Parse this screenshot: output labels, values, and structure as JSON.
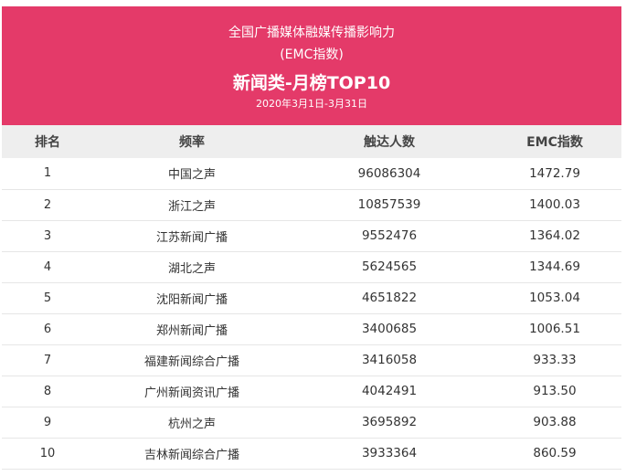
{
  "header": {
    "subtitle_line1": "全国广播媒体融媒传播影响力",
    "subtitle_line2": "(EMC指数)",
    "title": "新闻类-月榜TOP10",
    "date_range": "2020年3月1日-3月31日",
    "background_color": "#e43a69"
  },
  "table": {
    "columns": [
      "排名",
      "频率",
      "触达人数",
      "EMC指数"
    ],
    "rows": [
      {
        "rank": "1",
        "name": "中国之声",
        "reach": "96086304",
        "emc": "1472.79"
      },
      {
        "rank": "2",
        "name": "浙江之声",
        "reach": "10857539",
        "emc": "1400.03"
      },
      {
        "rank": "3",
        "name": "江苏新闻广播",
        "reach": "9552476",
        "emc": "1364.02"
      },
      {
        "rank": "4",
        "name": "湖北之声",
        "reach": "5624565",
        "emc": "1344.69"
      },
      {
        "rank": "5",
        "name": "沈阳新闻广播",
        "reach": "4651822",
        "emc": "1053.04"
      },
      {
        "rank": "6",
        "name": "郑州新闻广播",
        "reach": "3400685",
        "emc": "1006.51"
      },
      {
        "rank": "7",
        "name": "福建新闻综合广播",
        "reach": "3416058",
        "emc": "933.33"
      },
      {
        "rank": "8",
        "name": "广州新闻资讯广播",
        "reach": "4042491",
        "emc": "913.50"
      },
      {
        "rank": "9",
        "name": "杭州之声",
        "reach": "3695892",
        "emc": "903.88"
      },
      {
        "rank": "10",
        "name": "吉林新闻综合广播",
        "reach": "3933364",
        "emc": "860.59"
      }
    ]
  }
}
